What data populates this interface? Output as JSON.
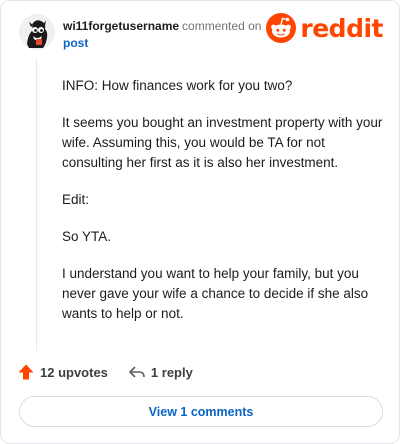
{
  "header": {
    "username": "wi11forgetusername",
    "action_text": "commented on",
    "target_text": "post",
    "logo_text": "reddit",
    "brand_color": "#ff4500",
    "link_color": "#0a63c6"
  },
  "comment": {
    "paragraphs": [
      "INFO: How finances work for you two?",
      "It seems you bought an investment property with your wife. Assuming this, you would be TA for not consulting her first as it is also her investment.",
      "Edit:",
      "So YTA.",
      "I understand you want to help your family, but you never gave your wife a chance to decide if she also wants to help or not."
    ]
  },
  "actions": {
    "upvotes_label": "12 upvotes",
    "reply_label": "1 reply",
    "upvote_icon": "upvote-arrow-icon",
    "reply_icon": "reply-arrow-icon"
  },
  "footer": {
    "view_button_label": "View 1 comments"
  }
}
